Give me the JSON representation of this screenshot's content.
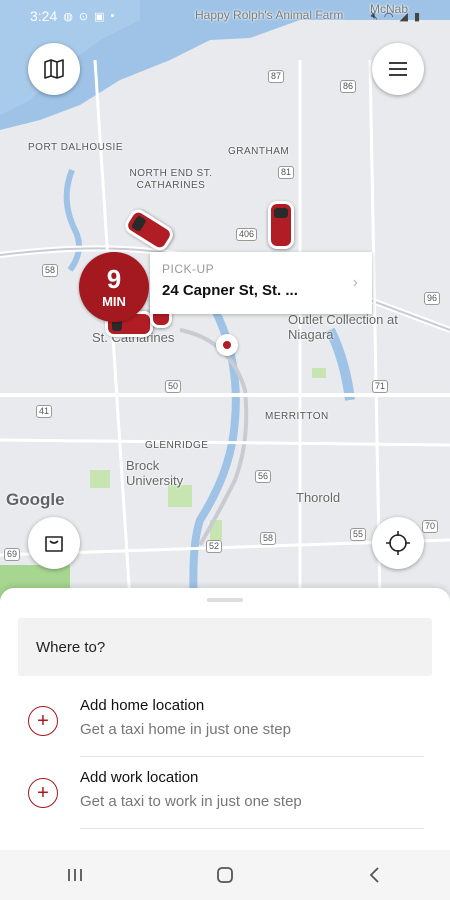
{
  "status_bar": {
    "time": "3:24",
    "icons": [
      "messenger-icon",
      "voicemail-icon",
      "gallery-icon",
      "dot-icon"
    ],
    "right_icons": [
      "mute-icon",
      "wifi-icon",
      "signal-icon",
      "battery-icon"
    ]
  },
  "map": {
    "labels": {
      "farm": "Happy Rolph's Animal Farm",
      "port": "PORT DALHOUSIE",
      "grantham": "GRANTHAM",
      "north_end": "NORTH END ST. CATHARINES",
      "city": "St. Catharines",
      "outlet": "Outlet Collection at Niagara",
      "merritton": "MERRITTON",
      "glenridge": "GLENRIDGE",
      "brock": "Brock University",
      "thorold": "Thorold",
      "mcnab": "McNab"
    },
    "shields": [
      "87",
      "86",
      "81",
      "406",
      "58",
      "50",
      "41",
      "96",
      "71",
      "56",
      "58",
      "52",
      "55",
      "69",
      "70"
    ],
    "google": "Google"
  },
  "pickup": {
    "eta_value": "9",
    "eta_unit": "MIN",
    "title": "PICK-UP",
    "address": "24 Capner St, St. ..."
  },
  "sheet": {
    "where_to": "Where to?",
    "home": {
      "title": "Add home location",
      "subtitle": "Get a taxi home in just one step"
    },
    "work": {
      "title": "Add work location",
      "subtitle": "Get a taxi to work in just one step"
    }
  },
  "colors": {
    "brand": "#a4181f",
    "water": "#9ec3e6",
    "park": "#c6e5b1"
  }
}
